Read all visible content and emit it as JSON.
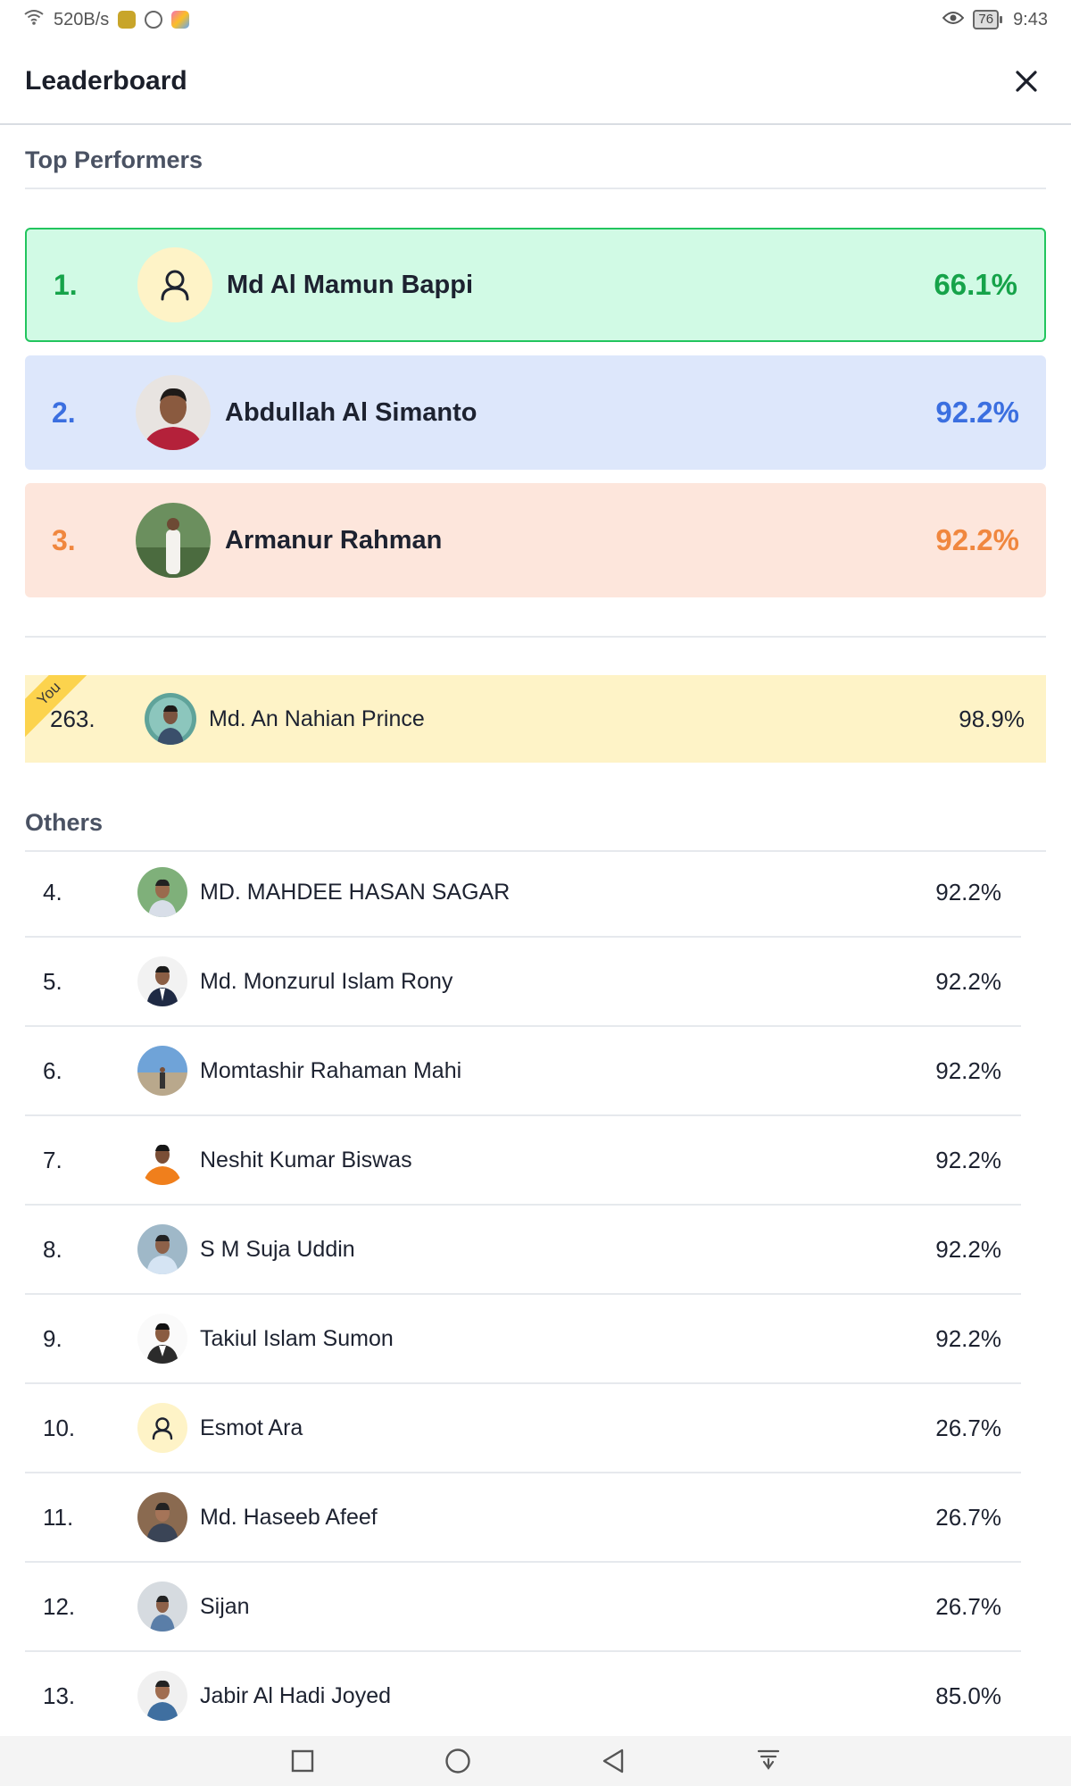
{
  "status_bar": {
    "net_speed": "520B/s",
    "battery": "76",
    "time": "9:43"
  },
  "header": {
    "title": "Leaderboard"
  },
  "top_section": {
    "title": "Top Performers",
    "items": [
      {
        "rank": "1.",
        "name": "Md Al Mamun Bappi",
        "score": "66.1%",
        "avatar": "user-placeholder-icon",
        "bg": "#d1fae5",
        "border": "#22c55e",
        "accent": "#16a34a"
      },
      {
        "rank": "2.",
        "name": "Abdullah Al Simanto",
        "score": "92.2%",
        "avatar": "photo",
        "bg": "#dde7fb",
        "accent": "#3b6fe0"
      },
      {
        "rank": "3.",
        "name": "Armanur Rahman",
        "score": "92.2%",
        "avatar": "photo",
        "bg": "#fde6dc",
        "accent": "#f0873f"
      }
    ]
  },
  "you": {
    "badge": "You",
    "rank": "263.",
    "name": "Md. An Nahian Prince",
    "score": "98.9%",
    "bg": "#fef3c7"
  },
  "others": {
    "title": "Others",
    "items": [
      {
        "rank": "4.",
        "name": "MD. MAHDEE HASAN SAGAR",
        "score": "92.2%"
      },
      {
        "rank": "5.",
        "name": "Md. Monzurul Islam Rony",
        "score": "92.2%"
      },
      {
        "rank": "6.",
        "name": "Momtashir Rahaman Mahi",
        "score": "92.2%"
      },
      {
        "rank": "7.",
        "name": "Neshit Kumar Biswas",
        "score": "92.2%"
      },
      {
        "rank": "8.",
        "name": "S M Suja Uddin",
        "score": "92.2%"
      },
      {
        "rank": "9.",
        "name": "Takiul Islam Sumon",
        "score": "92.2%"
      },
      {
        "rank": "10.",
        "name": "Esmot Ara",
        "score": "26.7%"
      },
      {
        "rank": "11.",
        "name": "Md. Haseeb Afeef",
        "score": "26.7%"
      },
      {
        "rank": "12.",
        "name": "Sijan",
        "score": "26.7%"
      },
      {
        "rank": "13.",
        "name": "Jabir Al Hadi Joyed",
        "score": "85.0%"
      }
    ]
  },
  "nav_bar": {
    "icons": [
      "square-recent-icon",
      "circle-home-icon",
      "triangle-back-icon",
      "notification-pull-icon"
    ]
  }
}
